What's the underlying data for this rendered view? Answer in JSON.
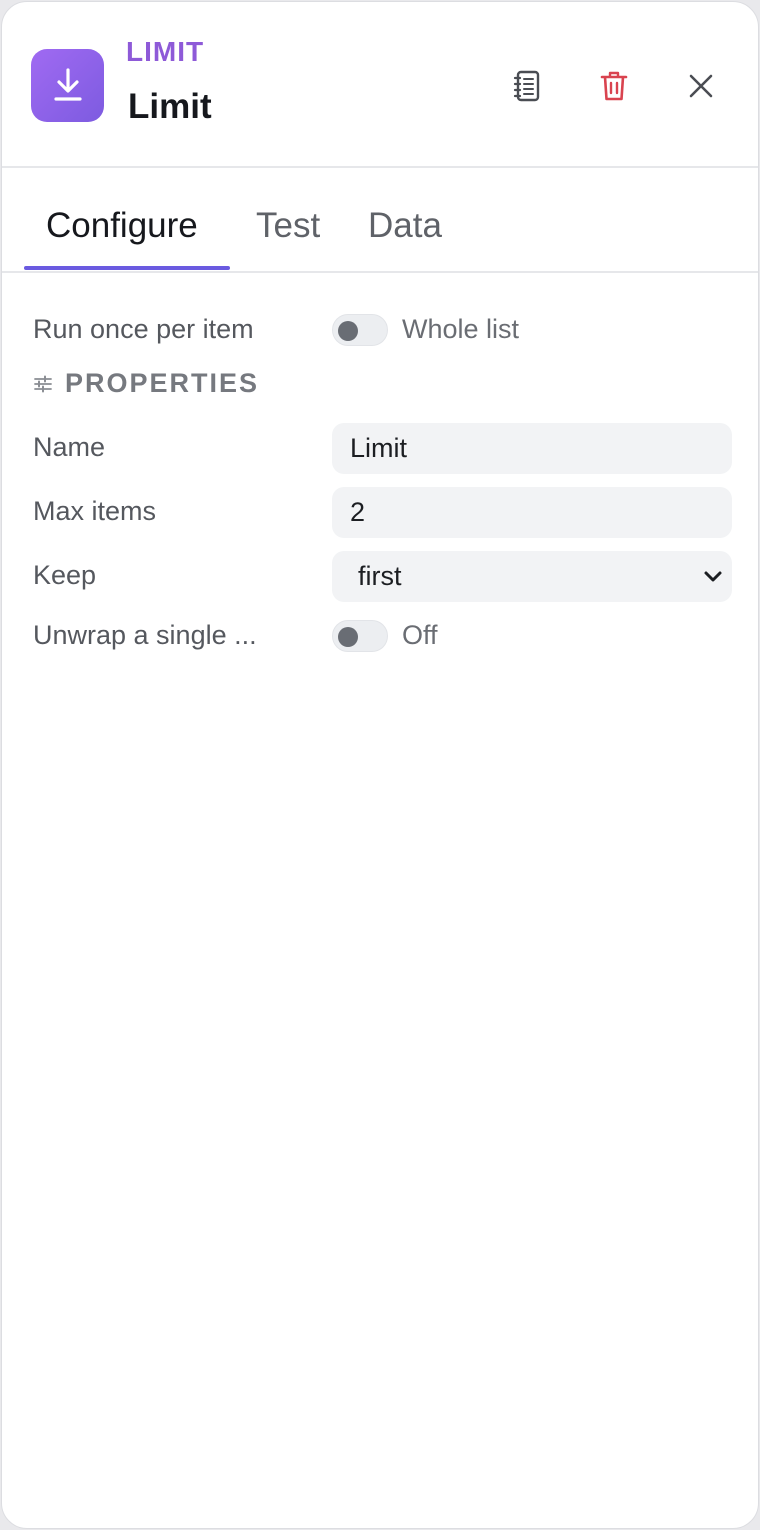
{
  "header": {
    "node_type": "LIMIT",
    "node_title": "Limit",
    "icon": "download-icon",
    "icon_color": "#8e5ad8",
    "actions": [
      "notes-icon",
      "trash-icon",
      "close-icon"
    ]
  },
  "tabs": [
    {
      "label": "Configure",
      "active": true
    },
    {
      "label": "Test",
      "active": false
    },
    {
      "label": "Data",
      "active": false
    }
  ],
  "mode": {
    "label": "Run once per item",
    "toggle_on": false,
    "toggle_text": "Whole list"
  },
  "properties": {
    "section_title": "PROPERTIES",
    "icon": "sliders-icon",
    "name": {
      "label": "Name",
      "value": "Limit"
    },
    "max_items": {
      "label": "Max items",
      "value": "2"
    },
    "keep": {
      "label": "Keep",
      "value": "first"
    },
    "unwrap": {
      "label": "Unwrap a single ...",
      "toggle_on": false,
      "toggle_text": "Off"
    }
  },
  "colors": {
    "accent": "#6a5ae0",
    "delete": "#d9434f"
  }
}
